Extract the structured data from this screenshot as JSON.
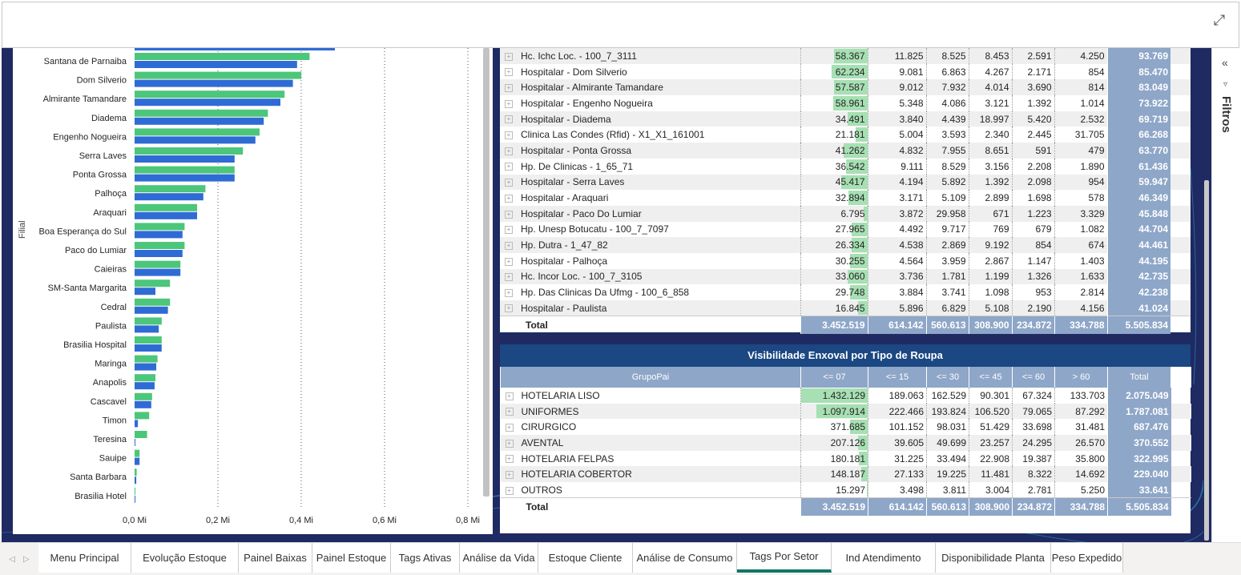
{
  "window": {
    "expand_icon": "expand-icon"
  },
  "chart_data": {
    "type": "bar",
    "ylabel": "Filial",
    "x_ticks": [
      "0,0 Mi",
      "0,2 Mi",
      "0,4 Mi",
      "0,6 Mi",
      "0,8 Mi"
    ],
    "xlim": [
      0,
      0.8
    ],
    "categories": [
      "Santana de Parnaiba",
      "Dom Silverio",
      "Almirante Tamandare",
      "Diadema",
      "Engenho Nogueira",
      "Serra Laves",
      "Ponta Grossa",
      "Palhoça",
      "Araquari",
      "Boa Esperança do Sul",
      "Paco do Lumiar",
      "Caieiras",
      "SM-Santa Margarita",
      "Cedral",
      "Paulista",
      "Brasilia Hospital",
      "Maringa",
      "Anapolis",
      "Cascavel",
      "Timon",
      "Teresina",
      "Sauipe",
      "Santa Barbara",
      "Brasilia Hotel"
    ],
    "series": [
      {
        "color": "#4cc67a",
        "values": [
          0.42,
          0.4,
          0.36,
          0.32,
          0.3,
          0.26,
          0.24,
          0.17,
          0.15,
          0.12,
          0.12,
          0.11,
          0.085,
          0.085,
          0.065,
          0.065,
          0.055,
          0.05,
          0.042,
          0.035,
          0.03,
          0.012,
          0.005,
          0.002
        ]
      },
      {
        "color": "#2f6bd4",
        "values": [
          0.39,
          0.38,
          0.35,
          0.31,
          0.29,
          0.24,
          0.24,
          0.165,
          0.15,
          0.115,
          0.115,
          0.11,
          0.05,
          0.08,
          0.058,
          0.065,
          0.052,
          0.048,
          0.04,
          0.008,
          0.0,
          0.012,
          0.004,
          0.002
        ]
      }
    ]
  },
  "table1": {
    "rows": [
      {
        "name": "Hc. Ichc Loc. - 100_7_3111",
        "v": [
          "58.367",
          "11.825",
          "8.525",
          "8.453",
          "2.591",
          "4.250"
        ],
        "total": "93.769",
        "bar": 0.5
      },
      {
        "name": "Hospitalar - Dom Silverio",
        "v": [
          "62.234",
          "9.081",
          "6.863",
          "4.267",
          "2.171",
          "854"
        ],
        "total": "85.470",
        "bar": 0.54
      },
      {
        "name": "Hospitalar - Almirante Tamandare",
        "v": [
          "57.587",
          "9.012",
          "7.932",
          "4.014",
          "3.690",
          "814"
        ],
        "total": "83.049",
        "bar": 0.5
      },
      {
        "name": "Hospitalar - Engenho Nogueira",
        "v": [
          "58.961",
          "5.348",
          "4.086",
          "3.121",
          "1.392",
          "1.014"
        ],
        "total": "73.922",
        "bar": 0.51
      },
      {
        "name": "Hospitalar - Diadema",
        "v": [
          "34.491",
          "3.840",
          "4.439",
          "18.997",
          "5.420",
          "2.532"
        ],
        "total": "69.719",
        "bar": 0.3
      },
      {
        "name": "Clinica Las Condes (Rfid) - X1_X1_161001",
        "v": [
          "21.181",
          "5.004",
          "3.593",
          "2.340",
          "2.445",
          "31.705"
        ],
        "total": "66.268",
        "bar": 0.18
      },
      {
        "name": "Hospitalar - Ponta Grossa",
        "v": [
          "41.262",
          "4.832",
          "7.955",
          "8.651",
          "591",
          "479"
        ],
        "total": "63.770",
        "bar": 0.36
      },
      {
        "name": "Hp. De Clinicas - 1_65_71",
        "v": [
          "36.542",
          "9.111",
          "8.529",
          "3.156",
          "2.208",
          "1.890"
        ],
        "total": "61.436",
        "bar": 0.32
      },
      {
        "name": "Hospitalar - Serra Laves",
        "v": [
          "45.417",
          "4.194",
          "5.892",
          "1.392",
          "2.098",
          "954"
        ],
        "total": "59.947",
        "bar": 0.39
      },
      {
        "name": "Hospitalar - Araquari",
        "v": [
          "32.894",
          "3.171",
          "5.109",
          "2.899",
          "1.698",
          "578"
        ],
        "total": "46.349",
        "bar": 0.28
      },
      {
        "name": "Hospitalar - Paco Do Lumiar",
        "v": [
          "6.795",
          "3.872",
          "29.958",
          "671",
          "1.223",
          "3.329"
        ],
        "total": "45.848",
        "bar": 0.06
      },
      {
        "name": "Hp. Unesp Botucatu - 100_7_7097",
        "v": [
          "27.965",
          "4.492",
          "9.717",
          "769",
          "679",
          "1.082"
        ],
        "total": "44.704",
        "bar": 0.24
      },
      {
        "name": "Hp. Dutra - 1_47_82",
        "v": [
          "26.334",
          "4.538",
          "2.869",
          "9.192",
          "854",
          "674"
        ],
        "total": "44.461",
        "bar": 0.23
      },
      {
        "name": "Hospitalar - Palhoça",
        "v": [
          "30.255",
          "4.564",
          "3.959",
          "2.867",
          "1.147",
          "1.403"
        ],
        "total": "44.195",
        "bar": 0.26
      },
      {
        "name": "Hc. Incor Loc. - 100_7_3105",
        "v": [
          "33.060",
          "3.736",
          "1.781",
          "1.199",
          "1.326",
          "1.633"
        ],
        "total": "42.735",
        "bar": 0.29
      },
      {
        "name": "Hp. Das Clinicas Da Ufmg - 100_6_858",
        "v": [
          "29.748",
          "3.884",
          "3.741",
          "1.098",
          "953",
          "2.814"
        ],
        "total": "42.238",
        "bar": 0.26
      },
      {
        "name": "Hospitalar - Paulista",
        "v": [
          "16.845",
          "5.896",
          "6.829",
          "5.108",
          "2.190",
          "4.156"
        ],
        "total": "41.024",
        "bar": 0.14
      }
    ],
    "total": {
      "label": "Total",
      "v": [
        "3.452.519",
        "614.142",
        "560.613",
        "308.900",
        "234.872",
        "334.788"
      ],
      "total": "5.505.834"
    }
  },
  "table2": {
    "title": "Visibilidade Enxoval por Tipo de Roupa",
    "headers": [
      "GrupoPai",
      "<= 07",
      "<= 15",
      "<= 30",
      "<= 45",
      "<= 60",
      "> 60",
      "Total"
    ],
    "rows": [
      {
        "name": "HOTELARIA LISO",
        "v": [
          "1.432.129",
          "189.063",
          "162.529",
          "90.301",
          "67.324",
          "133.703"
        ],
        "total": "2.075.049",
        "bar": 1.0
      },
      {
        "name": "UNIFORMES",
        "v": [
          "1.097.914",
          "222.466",
          "193.824",
          "106.520",
          "79.065",
          "87.292"
        ],
        "total": "1.787.081",
        "bar": 0.77
      },
      {
        "name": "CIRURGICO",
        "v": [
          "371.685",
          "101.152",
          "98.031",
          "51.429",
          "33.698",
          "31.481"
        ],
        "total": "687.476",
        "bar": 0.26
      },
      {
        "name": "AVENTAL",
        "v": [
          "207.126",
          "39.605",
          "49.699",
          "23.257",
          "24.295",
          "26.570"
        ],
        "total": "370.552",
        "bar": 0.15
      },
      {
        "name": "HOTELARIA FELPAS",
        "v": [
          "180.181",
          "31.225",
          "33.494",
          "22.908",
          "19.387",
          "35.800"
        ],
        "total": "322.995",
        "bar": 0.13
      },
      {
        "name": "HOTELARIA COBERTOR",
        "v": [
          "148.187",
          "27.133",
          "19.225",
          "11.481",
          "8.322",
          "14.692"
        ],
        "total": "229.040",
        "bar": 0.1
      },
      {
        "name": "OUTROS",
        "v": [
          "15.297",
          "3.498",
          "3.811",
          "3.004",
          "2.781",
          "5.250"
        ],
        "total": "33.641",
        "bar": 0.01
      }
    ],
    "total": {
      "label": "Total",
      "v": [
        "3.452.519",
        "614.142",
        "560.613",
        "308.900",
        "234.872",
        "334.788"
      ],
      "total": "5.505.834"
    }
  },
  "filters": {
    "label": "Filtros"
  },
  "tabs": [
    {
      "label": "Menu Principal",
      "active": false
    },
    {
      "label": "Evolução Estoque",
      "active": false
    },
    {
      "label": "Painel Baixas",
      "active": false
    },
    {
      "label": "Painel Estoque",
      "active": false
    },
    {
      "label": "Tags Ativas",
      "active": false
    },
    {
      "label": "Análise da Vida",
      "active": false
    },
    {
      "label": "Estoque Cliente",
      "active": false
    },
    {
      "label": "Análise de Consumo",
      "active": false
    },
    {
      "label": "Tags Por Setor",
      "active": true
    },
    {
      "label": "Ind Atendimento",
      "active": false
    },
    {
      "label": "Disponibilidade Planta",
      "active": false
    },
    {
      "label": "Peso Expedido",
      "active": false
    }
  ]
}
